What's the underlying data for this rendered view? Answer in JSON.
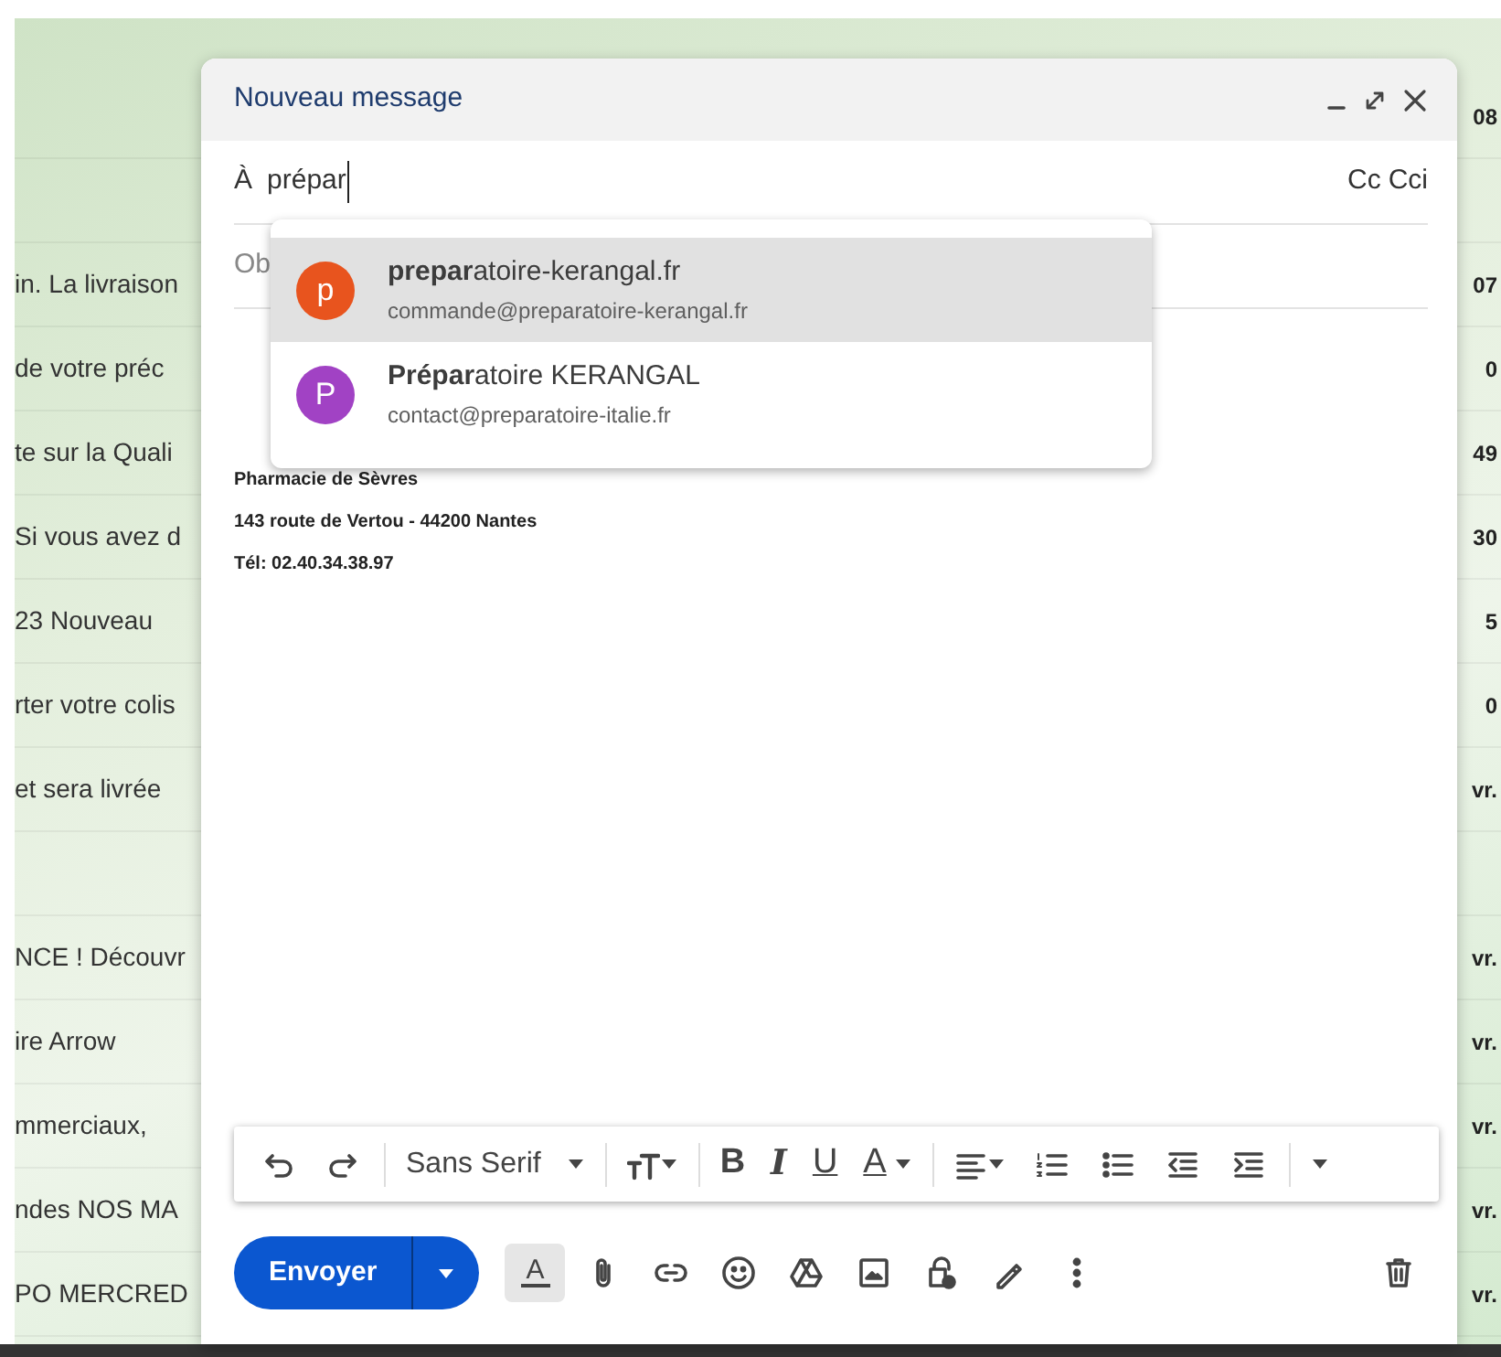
{
  "mail_list": {
    "rows": [
      {
        "kind": "mail",
        "date": "08"
      },
      {
        "kind": "blank"
      },
      {
        "kind": "mail",
        "snippet": "in. La livraison",
        "date": "07"
      },
      {
        "kind": "mail",
        "snippet": "de votre préc",
        "date": "0"
      },
      {
        "kind": "mail",
        "snippet": "te sur la Quali",
        "date": "49"
      },
      {
        "kind": "mail",
        "snippet": "Si vous avez d",
        "date": "30"
      },
      {
        "kind": "mail",
        "snippet": "23 Nouveau",
        "date": "5"
      },
      {
        "kind": "mail",
        "snippet": "rter votre colis",
        "date": "0"
      },
      {
        "kind": "mail",
        "snippet": "et sera livrée",
        "date": "vr."
      },
      {
        "kind": "blank"
      },
      {
        "kind": "mail",
        "snippet": "NCE ! Découvr",
        "date": "vr."
      },
      {
        "kind": "mail",
        "snippet": "ire Arrow",
        "date": "vr."
      },
      {
        "kind": "mail",
        "snippet": "mmerciaux,",
        "date": "vr."
      },
      {
        "kind": "mail",
        "snippet": "ndes NOS MA",
        "date": "vr."
      },
      {
        "kind": "mail",
        "snippet": "PO MERCRED",
        "date": "vr."
      }
    ]
  },
  "compose": {
    "title": "Nouveau message",
    "to": {
      "label": "À",
      "value": "prépar",
      "cc": "Cc",
      "bcc": "Cci"
    },
    "subject": {
      "placeholder": "Ob"
    },
    "signature": [
      "Pharmacie de Sèvres",
      "143 route de Vertou - 44200 Nantes",
      "Tél: 02.40.34.38.97"
    ],
    "suggestions": [
      {
        "initial": "p",
        "color": "#e8541e",
        "name": "**prepar**atoire-kerangal.fr",
        "email": "commande@preparatoire-kerangal.fr",
        "selected": true
      },
      {
        "initial": "P",
        "color": "#a142c4",
        "name": "**Prépar**atoire KERANGAL",
        "email": "contact@preparatoire-italie.fr",
        "selected": false
      }
    ],
    "format_bar": {
      "font": "Sans Serif",
      "bold": "B",
      "italic": "I",
      "underline": "U",
      "text_color": "A"
    },
    "send_button": "Envoyer",
    "formatting_toggle": {
      "label": "A",
      "selected": true
    }
  }
}
